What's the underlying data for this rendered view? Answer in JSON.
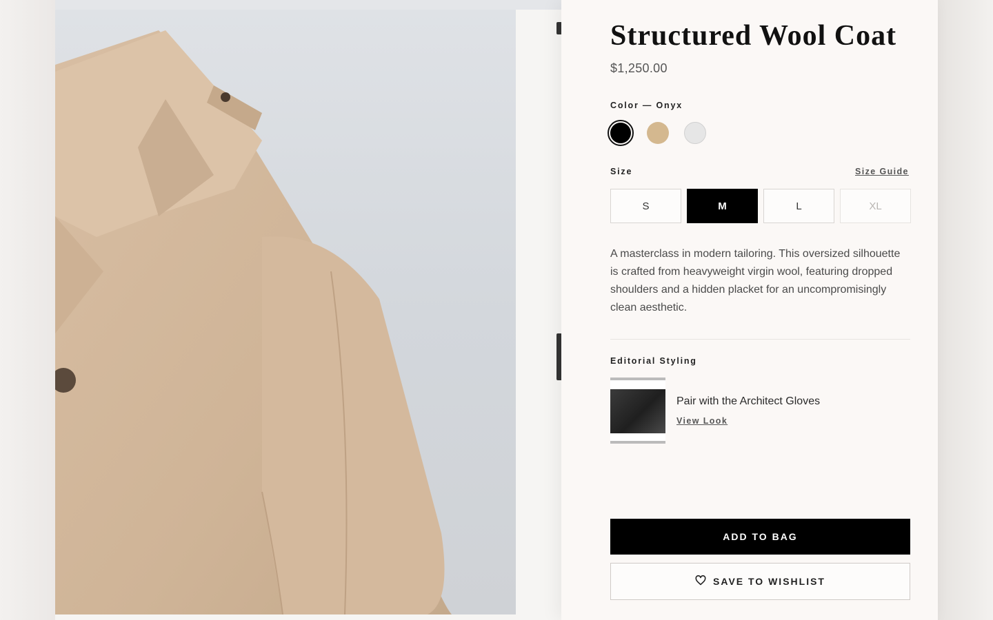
{
  "product": {
    "title": "Structured Wool Coat",
    "price": "$1,250.00"
  },
  "color": {
    "label": "Color — Onyx",
    "options": [
      {
        "name": "Onyx",
        "hex": "#000000",
        "selected": true
      },
      {
        "name": "Camel",
        "hex": "#d4b88f",
        "selected": false
      },
      {
        "name": "Ivory",
        "hex": "#e6e6e6",
        "selected": false
      }
    ]
  },
  "size": {
    "label": "Size",
    "guide_label": "Size Guide",
    "options": [
      {
        "label": "S",
        "state": "available"
      },
      {
        "label": "M",
        "state": "selected"
      },
      {
        "label": "L",
        "state": "available"
      },
      {
        "label": "XL",
        "state": "unavailable"
      }
    ]
  },
  "description": "A masterclass in modern tailoring. This oversized silhouette is crafted from heavyweight virgin wool, featuring dropped shoulders and a hidden placket for an uncompromisingly clean aesthetic.",
  "editorial": {
    "label": "Editorial Styling",
    "title": "Pair with the Architect Gloves",
    "link_label": "View Look"
  },
  "actions": {
    "add_to_bag": "ADD TO BAG",
    "save_to_wishlist": "SAVE TO WISHLIST",
    "wishlist_icon": "heart-icon"
  },
  "colors": {
    "panel_bg": "#fbf8f6",
    "primary": "#000000",
    "coat": "#d2b79a"
  }
}
